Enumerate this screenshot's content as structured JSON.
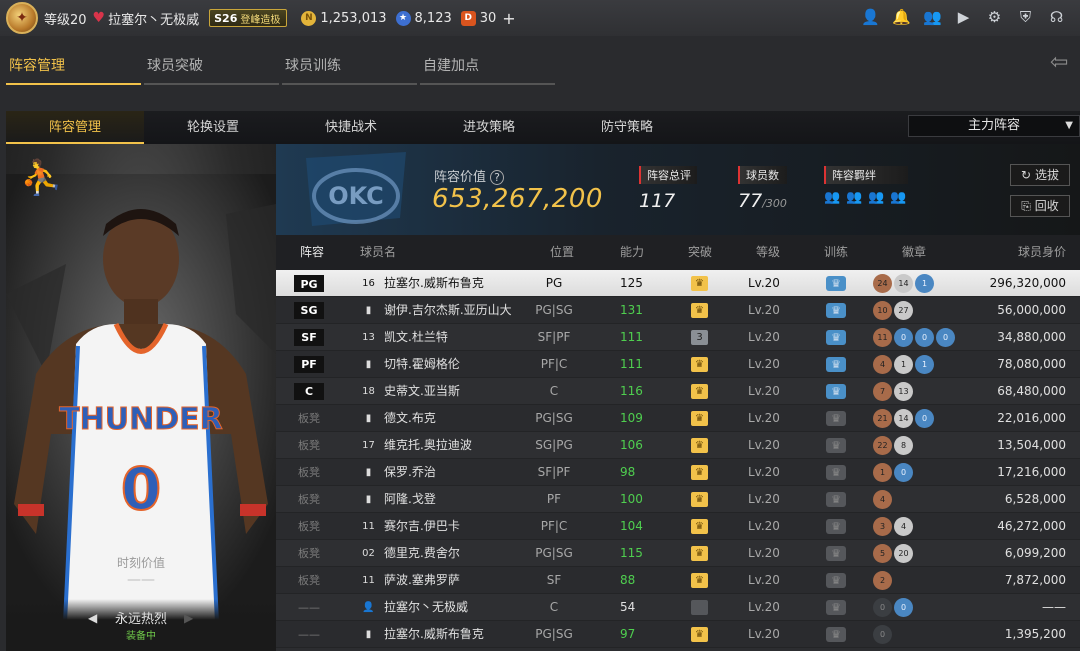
{
  "topbar": {
    "level": "等级20",
    "team_name": "拉塞尔丶无极威",
    "season_code": "S26",
    "season_label": "登峰造极",
    "gold": "1,253,013",
    "stars": "8,123",
    "tickets": "30",
    "plus": "+"
  },
  "main_tabs": [
    "阵容管理",
    "球员突破",
    "球员训练",
    "自建加点"
  ],
  "sub_tabs": [
    "阵容管理",
    "轮换设置",
    "快捷战术",
    "进攻策略",
    "防守策略"
  ],
  "lineup_select": "主力阵容",
  "card": {
    "value_label": "时刻价值",
    "value": "——",
    "name": "永远热烈",
    "status": "装备中"
  },
  "summary": {
    "value_label": "阵容价值",
    "value": "653,267,200",
    "overall_label": "阵容总评",
    "overall": "117",
    "count_label": "球员数",
    "count": "77",
    "count_max": "/300",
    "chem_label": "阵容羁绊",
    "btn_select": "选拔",
    "btn_recycle": "回收"
  },
  "table": {
    "headers": [
      "阵容",
      "球员名",
      "位置",
      "能力",
      "突破",
      "等级",
      "训练",
      "徽章",
      "球员身价"
    ],
    "rows": [
      {
        "slot": "PG",
        "num": "16",
        "name": "拉塞尔.威斯布鲁克",
        "pos": "PG",
        "ovr": "125",
        "brk": "gold",
        "brk_text": "",
        "lv": "Lv.20",
        "train": "on",
        "badges": [
          "24",
          "14",
          "1"
        ],
        "value": "296,320,000"
      },
      {
        "slot": "SG",
        "num": "",
        "name": "谢伊.吉尔杰斯.亚历山大",
        "pos": "PG|SG",
        "ovr": "131",
        "brk": "gold",
        "brk_text": "",
        "lv": "Lv.20",
        "train": "on",
        "badges": [
          "10",
          "27"
        ],
        "value": "56,000,000"
      },
      {
        "slot": "SF",
        "num": "13",
        "name": "凯文.杜兰特",
        "pos": "SF|PF",
        "ovr": "111",
        "brk": "grey",
        "brk_text": "3",
        "lv": "Lv.20",
        "train": "on",
        "badges": [
          "11",
          "0",
          "0",
          "0"
        ],
        "value": "34,880,000"
      },
      {
        "slot": "PF",
        "num": "",
        "name": "切特.霍姆格伦",
        "pos": "PF|C",
        "ovr": "111",
        "brk": "gold",
        "brk_text": "",
        "lv": "Lv.20",
        "train": "on",
        "badges": [
          "4",
          "1",
          "1"
        ],
        "value": "78,080,000"
      },
      {
        "slot": "C",
        "num": "18",
        "name": "史蒂文.亚当斯",
        "pos": "C",
        "ovr": "116",
        "brk": "gold",
        "brk_text": "",
        "lv": "Lv.20",
        "train": "on",
        "badges": [
          "7",
          "13"
        ],
        "value": "68,480,000"
      },
      {
        "slot": "板凳",
        "num": "",
        "name": "德文.布克",
        "pos": "PG|SG",
        "ovr": "109",
        "brk": "gold",
        "brk_text": "",
        "lv": "Lv.20",
        "train": "off",
        "badges": [
          "21",
          "14",
          "0"
        ],
        "value": "22,016,000"
      },
      {
        "slot": "板凳",
        "num": "17",
        "name": "维克托.奥拉迪波",
        "pos": "SG|PG",
        "ovr": "106",
        "brk": "gold",
        "brk_text": "",
        "lv": "Lv.20",
        "train": "off",
        "badges": [
          "22",
          "8"
        ],
        "value": "13,504,000"
      },
      {
        "slot": "板凳",
        "num": "",
        "name": "保罗.乔治",
        "pos": "SF|PF",
        "ovr": "98",
        "brk": "gold",
        "brk_text": "",
        "lv": "Lv.20",
        "train": "off",
        "badges": [
          "1",
          "0"
        ],
        "value": "17,216,000"
      },
      {
        "slot": "板凳",
        "num": "",
        "name": "阿隆.戈登",
        "pos": "PF",
        "ovr": "100",
        "brk": "gold",
        "brk_text": "",
        "lv": "Lv.20",
        "train": "off",
        "badges": [
          "4"
        ],
        "value": "6,528,000"
      },
      {
        "slot": "板凳",
        "num": "11",
        "name": "赛尔吉.伊巴卡",
        "pos": "PF|C",
        "ovr": "104",
        "brk": "gold",
        "brk_text": "",
        "lv": "Lv.20",
        "train": "off",
        "badges": [
          "3",
          "4"
        ],
        "value": "46,272,000"
      },
      {
        "slot": "板凳",
        "num": "02",
        "name": "德里克.费舍尔",
        "pos": "PG|SG",
        "ovr": "115",
        "brk": "gold",
        "brk_text": "",
        "lv": "Lv.20",
        "train": "off",
        "badges": [
          "5",
          "20"
        ],
        "value": "6,099,200"
      },
      {
        "slot": "板凳",
        "num": "11",
        "name": "萨波.塞弗罗萨",
        "pos": "SF",
        "ovr": "88",
        "brk": "gold",
        "brk_text": "",
        "lv": "Lv.20",
        "train": "off",
        "badges": [
          "2"
        ],
        "value": "7,872,000"
      },
      {
        "slot": "——",
        "num": "",
        "name": "拉塞尔丶无极威",
        "pos": "C",
        "ovr": "54",
        "brk": "off",
        "brk_text": "",
        "lv": "Lv.20",
        "train": "off",
        "badges": [
          "0",
          "0"
        ],
        "value": "——"
      },
      {
        "slot": "——",
        "num": "",
        "name": "拉塞尔.威斯布鲁克",
        "pos": "PG|SG",
        "ovr": "97",
        "brk": "gold",
        "brk_text": "",
        "lv": "Lv.20",
        "train": "off",
        "badges": [
          "0"
        ],
        "value": "1,395,200"
      }
    ]
  }
}
